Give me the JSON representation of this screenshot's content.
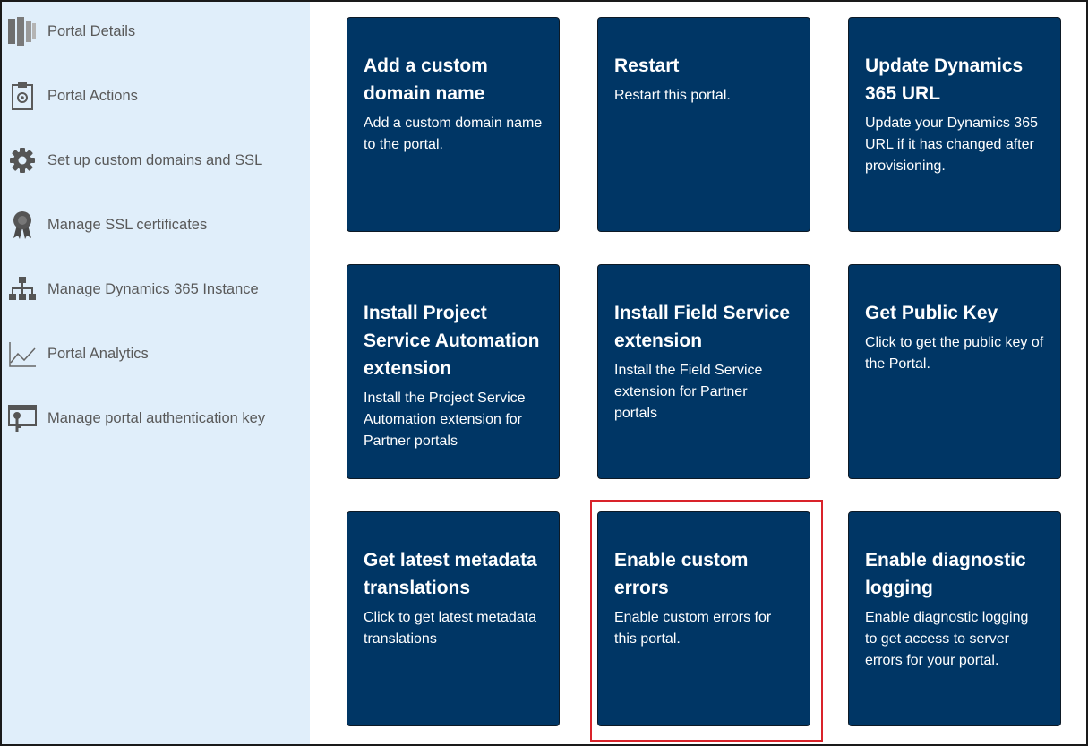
{
  "sidebar": {
    "items": [
      {
        "label": "Portal Details",
        "icon": "portal-details-icon"
      },
      {
        "label": "Portal Actions",
        "icon": "portal-actions-icon"
      },
      {
        "label": "Set up custom domains and SSL",
        "icon": "gear-icon"
      },
      {
        "label": "Manage SSL certificates",
        "icon": "certificate-icon"
      },
      {
        "label": "Manage Dynamics 365 Instance",
        "icon": "hierarchy-icon"
      },
      {
        "label": "Portal Analytics",
        "icon": "analytics-icon"
      },
      {
        "label": "Manage portal authentication key",
        "icon": "key-icon"
      }
    ]
  },
  "tiles": [
    {
      "title": "Add a custom domain name",
      "description": "Add a custom domain name to the portal."
    },
    {
      "title": "Restart",
      "description": "Restart this portal."
    },
    {
      "title": "Update Dynamics 365 URL",
      "description": "Update your Dynamics 365 URL if it has changed after provisioning."
    },
    {
      "title": "Install Project Service Automation extension",
      "description": "Install the Project Service Automation extension for Partner portals"
    },
    {
      "title": "Install Field Service extension",
      "description": "Install the Field Service extension for Partner portals"
    },
    {
      "title": "Get Public Key",
      "description": "Click to get the public key of the Portal."
    },
    {
      "title": "Get latest metadata translations",
      "description": "Click to get latest metadata translations"
    },
    {
      "title": "Enable custom errors",
      "description": "Enable custom errors for this portal."
    },
    {
      "title": "Enable diagnostic logging",
      "description": "Enable diagnostic logging to get access to server errors for your portal."
    }
  ],
  "highlighted_tile": "Enable custom errors",
  "colors": {
    "sidebar_bg": "#e0eefa",
    "tile_bg": "#003665",
    "highlight": "#d9232a",
    "label_text": "#595959"
  }
}
